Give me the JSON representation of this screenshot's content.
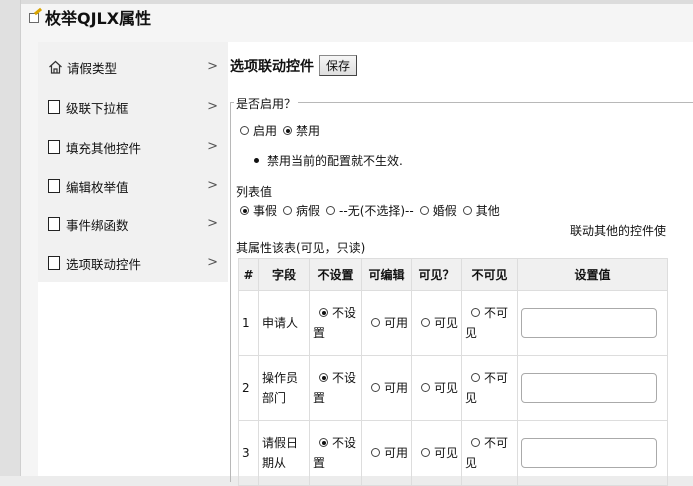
{
  "window": {
    "title": "枚举QJLX属性"
  },
  "sidebar": {
    "items": [
      {
        "label": "请假类型"
      },
      {
        "label": "级联下拉框"
      },
      {
        "label": "填充其他控件"
      },
      {
        "label": "编辑枚举值"
      },
      {
        "label": "事件绑函数"
      },
      {
        "label": "选项联动控件"
      }
    ],
    "chevron": ">"
  },
  "main": {
    "section_title": "选项联动控件",
    "save_label": "保存",
    "legend": "是否启用？",
    "enable_options": [
      {
        "label": "启用",
        "checked": false
      },
      {
        "label": "禁用",
        "checked": true
      }
    ],
    "note": "禁用当前的配置就不生效.",
    "list_label": "列表值",
    "list_options": [
      {
        "label": "事假",
        "checked": true
      },
      {
        "label": "病假",
        "checked": false
      },
      {
        "label": "--无(不选择)--",
        "checked": false
      },
      {
        "label": "婚假",
        "checked": false
      },
      {
        "label": "其他",
        "checked": false
      }
    ],
    "right_note": "联动其他的控件使",
    "attr_label": "其属性该表(可见，只读)",
    "table": {
      "headers": [
        "#",
        "字段",
        "不设置",
        "可编辑",
        "可见？",
        "不可见",
        "设置值"
      ],
      "rows": [
        {
          "num": "1",
          "field": "申请人",
          "opt1": "不设置",
          "opt2": "可用",
          "opt3": "可见",
          "opt4": "不可见"
        },
        {
          "num": "2",
          "field": "操作员部门",
          "opt1": "不设置",
          "opt2": "可用",
          "opt3": "可见",
          "opt4": "不可见"
        },
        {
          "num": "3",
          "field": "请假日期从",
          "opt1": "不设置",
          "opt2": "可用",
          "opt3": "可见",
          "opt4": "不可见"
        }
      ]
    }
  }
}
